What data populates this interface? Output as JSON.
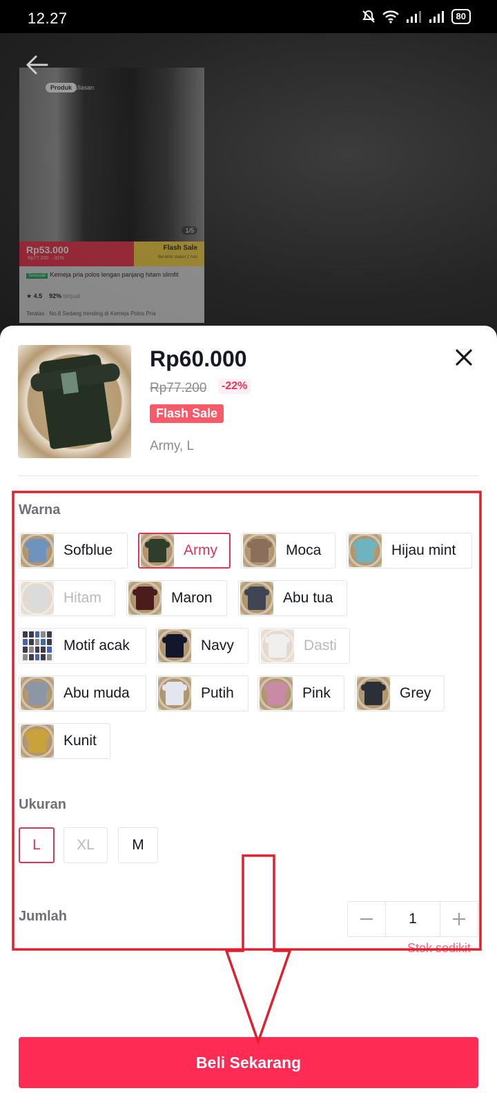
{
  "status_bar": {
    "time": "12.27",
    "battery": "80"
  },
  "preview": {
    "tab_active": "Produk",
    "tab_other": "Ulasan",
    "image_counter": "1/5",
    "flash_price": "Rp53.000",
    "flash_old": "Rp77.200 · -31%",
    "flash_label": "Flash Sale",
    "flash_sub": "Berakhir dalam 2 hari",
    "badge": "Termurah",
    "title": "Kemeja pria polos lengan panjang hitam slimfit",
    "rating": "4.5",
    "sold": "92%",
    "sold_label": "terjual",
    "trending": "Teratas · No.8 Sedang trending di Kemeja Polos Pria"
  },
  "product": {
    "price": "Rp60.000",
    "old_price": "Rp77.200",
    "discount": "-22%",
    "flash_label": "Flash Sale",
    "selected_variant": "Army, L"
  },
  "colors": {
    "label": "Warna",
    "options": [
      {
        "label": "Sofblue",
        "swatch": "#6f93bf",
        "state": "normal"
      },
      {
        "label": "Army",
        "swatch": "#2f3d2c",
        "state": "selected"
      },
      {
        "label": "Moca",
        "swatch": "#8c6f5b",
        "state": "normal"
      },
      {
        "label": "Hijau mint",
        "swatch": "#6fb3bf",
        "state": "normal"
      },
      {
        "label": "Hitam",
        "swatch": "#9a9a9a",
        "state": "disabled"
      },
      {
        "label": "Maron",
        "swatch": "#4a1c1c",
        "state": "normal"
      },
      {
        "label": "Abu tua",
        "swatch": "#3f4552",
        "state": "normal"
      },
      {
        "label": "Motif acak",
        "swatch": "#3b3b4a",
        "state": "normal"
      },
      {
        "label": "Navy",
        "swatch": "#12182b",
        "state": "normal"
      },
      {
        "label": "Dasti",
        "swatch": "#d9d3d0",
        "state": "disabled"
      },
      {
        "label": "Abu muda",
        "swatch": "#8c96a4",
        "state": "normal"
      },
      {
        "label": "Putih",
        "swatch": "#e3e6ee",
        "state": "normal"
      },
      {
        "label": "Pink",
        "swatch": "#c98aa6",
        "state": "normal"
      },
      {
        "label": "Grey",
        "swatch": "#2b2f36",
        "state": "normal"
      },
      {
        "label": "Kunit",
        "swatch": "#c9a23a",
        "state": "normal"
      }
    ]
  },
  "sizes": {
    "label": "Ukuran",
    "options": [
      {
        "label": "L",
        "state": "selected"
      },
      {
        "label": "XL",
        "state": "disabled"
      },
      {
        "label": "M",
        "state": "normal"
      }
    ]
  },
  "quantity": {
    "label": "Jumlah",
    "value": "1",
    "stock_note": "Stok sedikit"
  },
  "buy_button": "Beli Sekarang",
  "theme": {
    "accent": "#fe2c55",
    "selected_border": "#e0335a",
    "annotation": "#e0202c"
  },
  "icons": [
    "back-arrow-icon",
    "close-icon",
    "minus-icon",
    "plus-icon",
    "wifi-icon",
    "signal-icon",
    "mute-icon"
  ]
}
